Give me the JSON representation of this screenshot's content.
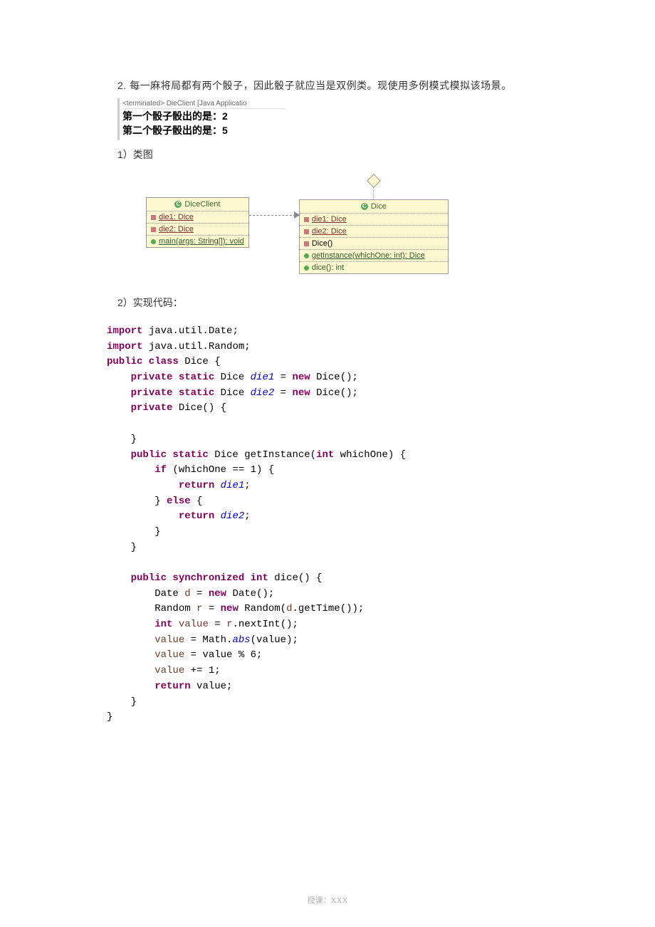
{
  "intro": "2. 每一麻将局都有两个骰子，因此骰子就应当是双例类。现使用多例模式模拟该场景。",
  "console": {
    "header": "<terminated> DieClient [Java Applicatio",
    "line1": "第一个骰子骰出的是：2",
    "line2": "第二个骰子骰出的是：5"
  },
  "section1": "1）类图",
  "section2": "2）实现代码：",
  "uml_client": {
    "title": "DiceClient",
    "field1": "die1: Dice",
    "field2": "die2: Dice",
    "method1": "main(args: String[]): void"
  },
  "uml_dice": {
    "title": "Dice",
    "field1": "die1: Dice",
    "field2": "die2: Dice",
    "ctor": "Dice()",
    "method1": "getInstance(whichOne: int): Dice",
    "method2": "dice(): int"
  },
  "code": {
    "l1a": "import",
    "l1b": " java.util.Date;",
    "l2a": "import",
    "l2b": " java.util.Random;",
    "l3a": "public class",
    "l3b": " Dice {",
    "l4a": "private static",
    "l4b": " Dice ",
    "l4c": "die1",
    "l4d": " = ",
    "l4e": "new",
    "l4f": " Dice();",
    "l5a": "private static",
    "l5b": " Dice ",
    "l5c": "die2",
    "l5d": " = ",
    "l5e": "new",
    "l5f": " Dice();",
    "l6a": "private",
    "l6b": " Dice() {",
    "l7": "    }",
    "l8a": "public static",
    "l8b": " Dice getInstance(",
    "l8c": "int",
    "l8d": " whichOne) {",
    "l9a": "if",
    "l9b": " (whichOne == 1) {",
    "l10a": "return",
    "l10b": "die1",
    "l10c": ";",
    "l11a": "} ",
    "l11b": "else",
    "l11c": " {",
    "l12a": "return",
    "l12b": "die2",
    "l12c": ";",
    "l13": "        }",
    "l14": "    }",
    "l15a": "public synchronized int",
    "l15b": " dice() {",
    "l16a": "        Date ",
    "l16v": "d",
    "l16b": " = ",
    "l16c": "new",
    "l16d": " Date();",
    "l17a": "        Random ",
    "l17v": "r",
    "l17b": " = ",
    "l17c": "new",
    "l17d": " Random(",
    "l17e": "d",
    "l17f": ".getTime());",
    "l18a": "int",
    "l18b": " value",
    "l18c": " = ",
    "l18d": "r",
    "l18e": ".nextInt();",
    "l19a": "        value",
    "l19b": " = Math.",
    "l19c": "abs",
    "l19d": "(value);",
    "l20a": "        value",
    "l20b": " = value % 6;",
    "l21a": "        value",
    "l21b": " += 1;",
    "l22a": "return",
    "l22b": " value;",
    "l23": "    }",
    "l24": "}"
  },
  "footer": "授课：XXX"
}
